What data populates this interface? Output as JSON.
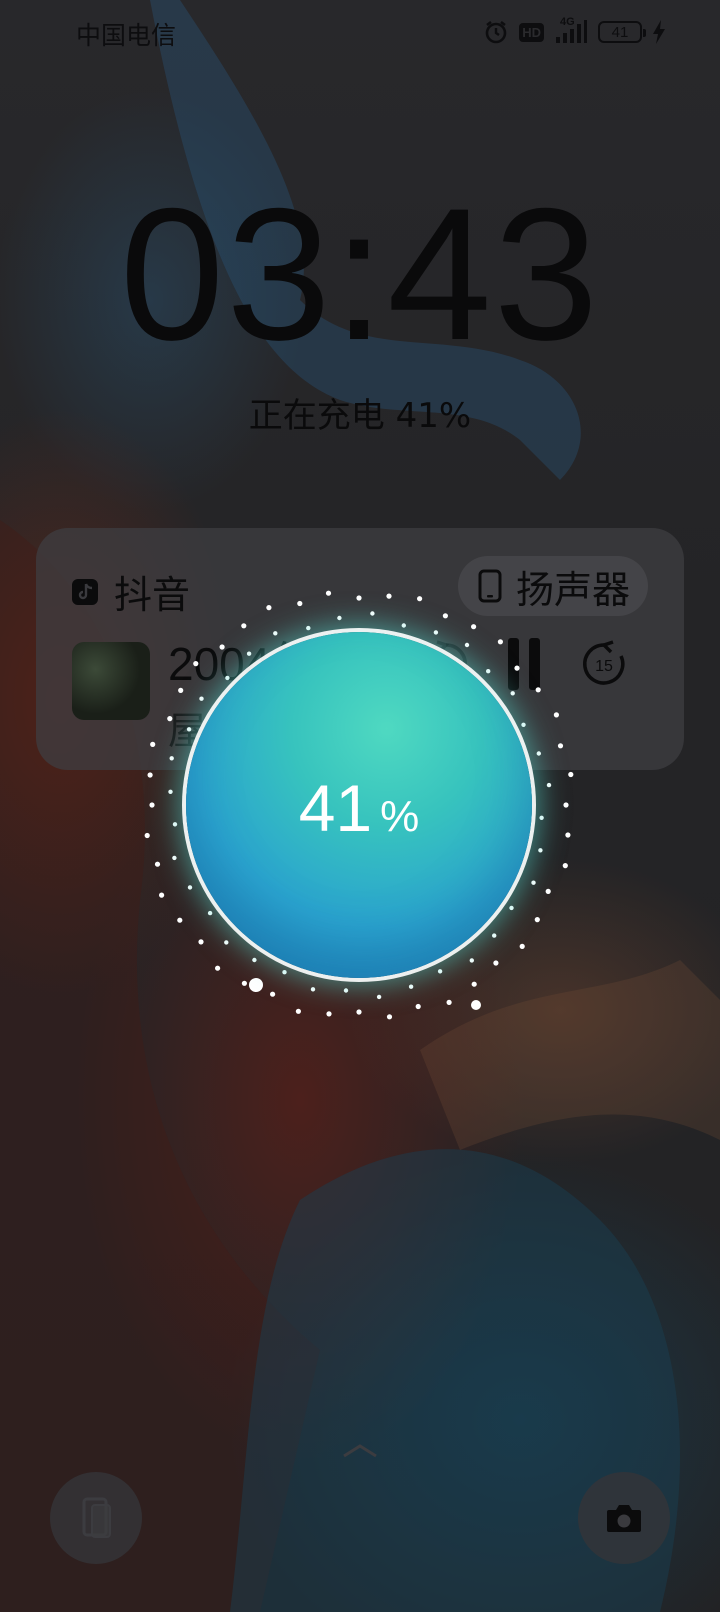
{
  "status_bar": {
    "carrier": "中国电信",
    "hd_label": "HD",
    "network_label": "4G",
    "battery_level": "41",
    "icons": [
      "alarm-icon",
      "hd-icon",
      "signal-4g-icon",
      "battery-icon",
      "charging-bolt-icon"
    ]
  },
  "clock": {
    "time": "03:43"
  },
  "charging": {
    "status_text": "正在充电 41%",
    "orb_value": "41",
    "orb_unit": "%",
    "level_fraction": 0.41
  },
  "media": {
    "app_name": "抖音",
    "app_icon": "douyin-icon",
    "output_device": "扬声器",
    "output_icon": "phone-speaker-icon",
    "song_title": "2004年...",
    "song_artist": "屋太冷...",
    "controls": {
      "rewind_label": "15",
      "forward_label": "15",
      "play_state": "playing"
    }
  },
  "bottom": {
    "left_shortcut_icon": "phone-clone-icon",
    "right_shortcut_icon": "camera-icon",
    "unlock_hint_icon": "chevron-up-icon"
  },
  "colors": {
    "orb_teal": "#37c3be",
    "orb_blue": "#2394c9",
    "text_dark": "#0a0a0b"
  }
}
